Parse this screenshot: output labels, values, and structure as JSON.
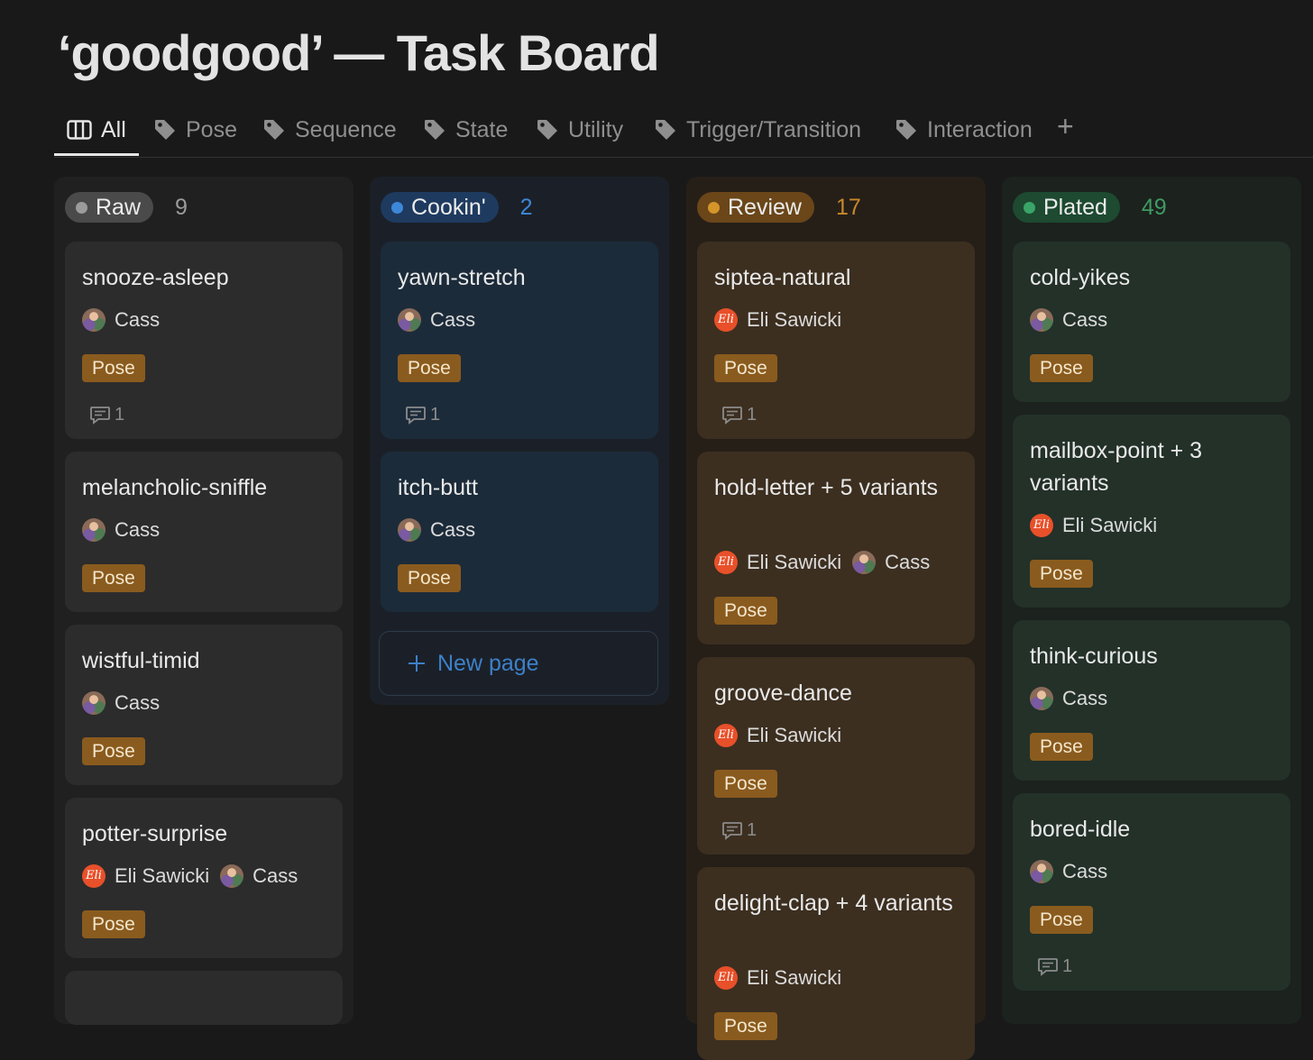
{
  "page": {
    "title": "‘goodgood’ — Task Board"
  },
  "tabs": [
    {
      "label": "All",
      "icon": "board-icon"
    },
    {
      "label": "Pose",
      "icon": "tag-icon"
    },
    {
      "label": "Sequence",
      "icon": "tag-icon"
    },
    {
      "label": "State",
      "icon": "tag-icon"
    },
    {
      "label": "Utility",
      "icon": "tag-icon"
    },
    {
      "label": "Trigger/Transition",
      "icon": "tag-icon"
    },
    {
      "label": "Interaction",
      "icon": "tag-icon"
    }
  ],
  "add_view_label": "+",
  "columns": [
    {
      "name": "Raw",
      "count": "9",
      "colors": {
        "bg": "#202020",
        "pill": "#4a4a4a",
        "dot": "#9b9b9b",
        "count": "#9b9b9b",
        "card": "#2c2c2c"
      },
      "cards": [
        {
          "title": "snooze-asleep",
          "people": [
            "Cass"
          ],
          "tag": "Pose",
          "comments": "1"
        },
        {
          "title": "melancholic-sniffle",
          "people": [
            "Cass"
          ],
          "tag": "Pose"
        },
        {
          "title": "wistful-timid",
          "people": [
            "Cass"
          ],
          "tag": "Pose"
        },
        {
          "title": "potter-surprise",
          "people": [
            "Eli Sawicki",
            "Cass"
          ],
          "tag": "Pose"
        }
      ]
    },
    {
      "name": "Cookin'",
      "count": "2",
      "colors": {
        "bg": "#1b2028",
        "pill": "#1e3a5f",
        "dot": "#3d87d9",
        "count": "#3d87d9",
        "card": "#1c2b3a"
      },
      "cards": [
        {
          "title": "yawn-stretch",
          "people": [
            "Cass"
          ],
          "tag": "Pose",
          "comments": "1"
        },
        {
          "title": "itch-butt",
          "people": [
            "Cass"
          ],
          "tag": "Pose"
        }
      ],
      "new_page_label": "New page"
    },
    {
      "name": "Review",
      "count": "17",
      "colors": {
        "bg": "#261f18",
        "pill": "#6a4619",
        "dot": "#d4952a",
        "count": "#c9882a",
        "card": "#3c2f20"
      },
      "cards": [
        {
          "title": "siptea-natural",
          "people": [
            "Eli Sawicki"
          ],
          "tag": "Pose",
          "comments": "1"
        },
        {
          "title": "hold-letter + 5 variants",
          "people": [
            "Eli Sawicki",
            "Cass"
          ],
          "tag": "Pose"
        },
        {
          "title": "groove-dance",
          "people": [
            "Eli Sawicki"
          ],
          "tag": "Pose",
          "comments": "1"
        },
        {
          "title": "delight-clap + 4 variants",
          "people": [
            "Eli Sawicki"
          ],
          "tag": "Pose"
        }
      ]
    },
    {
      "name": "Plated",
      "count": "49",
      "colors": {
        "bg": "#1c221e",
        "pill": "#1d4a30",
        "dot": "#3aa468",
        "count": "#3f9a62",
        "card": "#233129"
      },
      "cards": [
        {
          "title": "cold-yikes",
          "people": [
            "Cass"
          ],
          "tag": "Pose"
        },
        {
          "title": "mailbox-point + 3 variants",
          "people": [
            "Eli Sawicki"
          ],
          "tag": "Pose"
        },
        {
          "title": "think-curious",
          "people": [
            "Cass"
          ],
          "tag": "Pose"
        },
        {
          "title": "bored-idle",
          "people": [
            "Cass"
          ],
          "tag": "Pose",
          "comments": "1"
        }
      ]
    }
  ]
}
